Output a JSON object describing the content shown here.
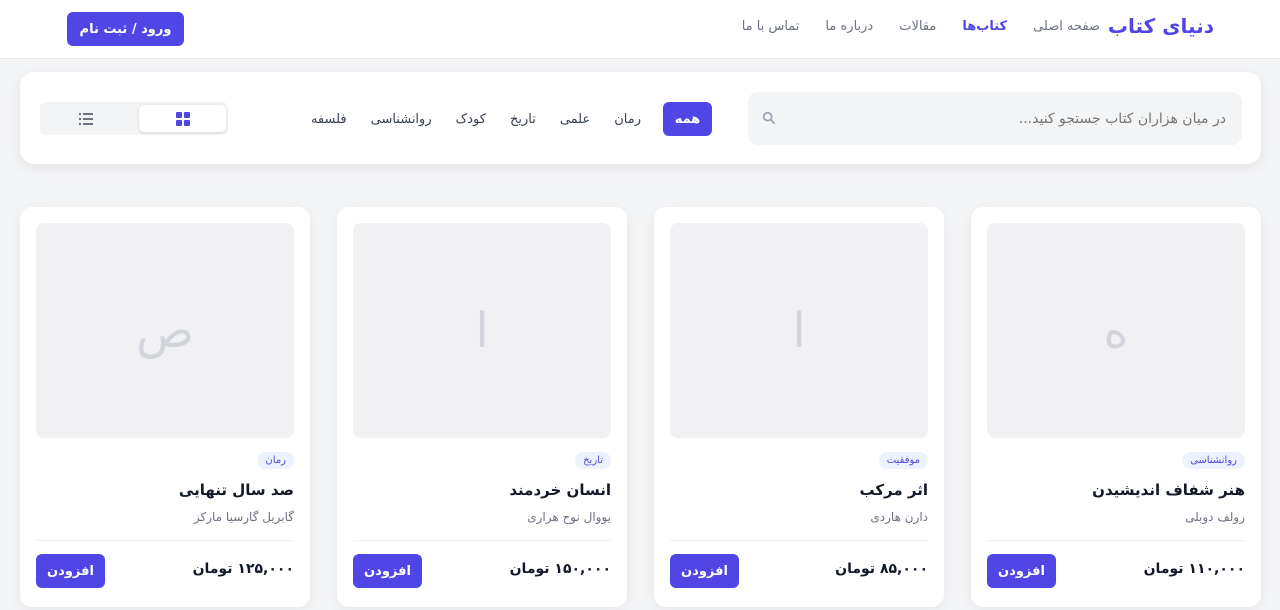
{
  "header": {
    "brand": "دنیای کتاب",
    "nav": [
      "صفحه اصلی",
      "کتاب‌ها",
      "مقالات",
      "درباره ما",
      "تماس با ما"
    ],
    "active_nav": "کتاب‌ها",
    "login_label": "ورود / ثبت نام"
  },
  "filters": {
    "search_placeholder": "در میان هزاران کتاب جستجو کنید...",
    "categories": [
      "همه",
      "رمان",
      "علمی",
      "تاریخ",
      "کودک",
      "روانشناسی",
      "فلسفه"
    ],
    "active_category": "همه",
    "view_modes": [
      "grid-icon",
      "list-icon"
    ],
    "active_view": "grid"
  },
  "books": [
    {
      "cover_letter": "ه",
      "tag": "روانشناسی",
      "title": "هنر شفاف اندیشیدن",
      "author": "رولف دوبلی",
      "price": "۱۱۰,۰۰۰ تومان",
      "add_label": "افزودن"
    },
    {
      "cover_letter": "ا",
      "tag": "موفقیت",
      "title": "اثر مرکب",
      "author": "دارن هاردی",
      "price": "۸۵,۰۰۰ تومان",
      "add_label": "افزودن"
    },
    {
      "cover_letter": "ا",
      "tag": "تاریخ",
      "title": "انسان خردمند",
      "author": "یووال نوح هراری",
      "price": "۱۵۰,۰۰۰ تومان",
      "add_label": "افزودن"
    },
    {
      "cover_letter": "ص",
      "tag": "رمان",
      "title": "صد سال تنهایی",
      "author": "گابریل گارسیا مارکز",
      "price": "۱۲۵,۰۰۰ تومان",
      "add_label": "افزودن"
    }
  ],
  "colors": {
    "accent": "#4f46e5",
    "tag_bg": "#eef2ff",
    "page_bg": "#f3f4f6"
  }
}
